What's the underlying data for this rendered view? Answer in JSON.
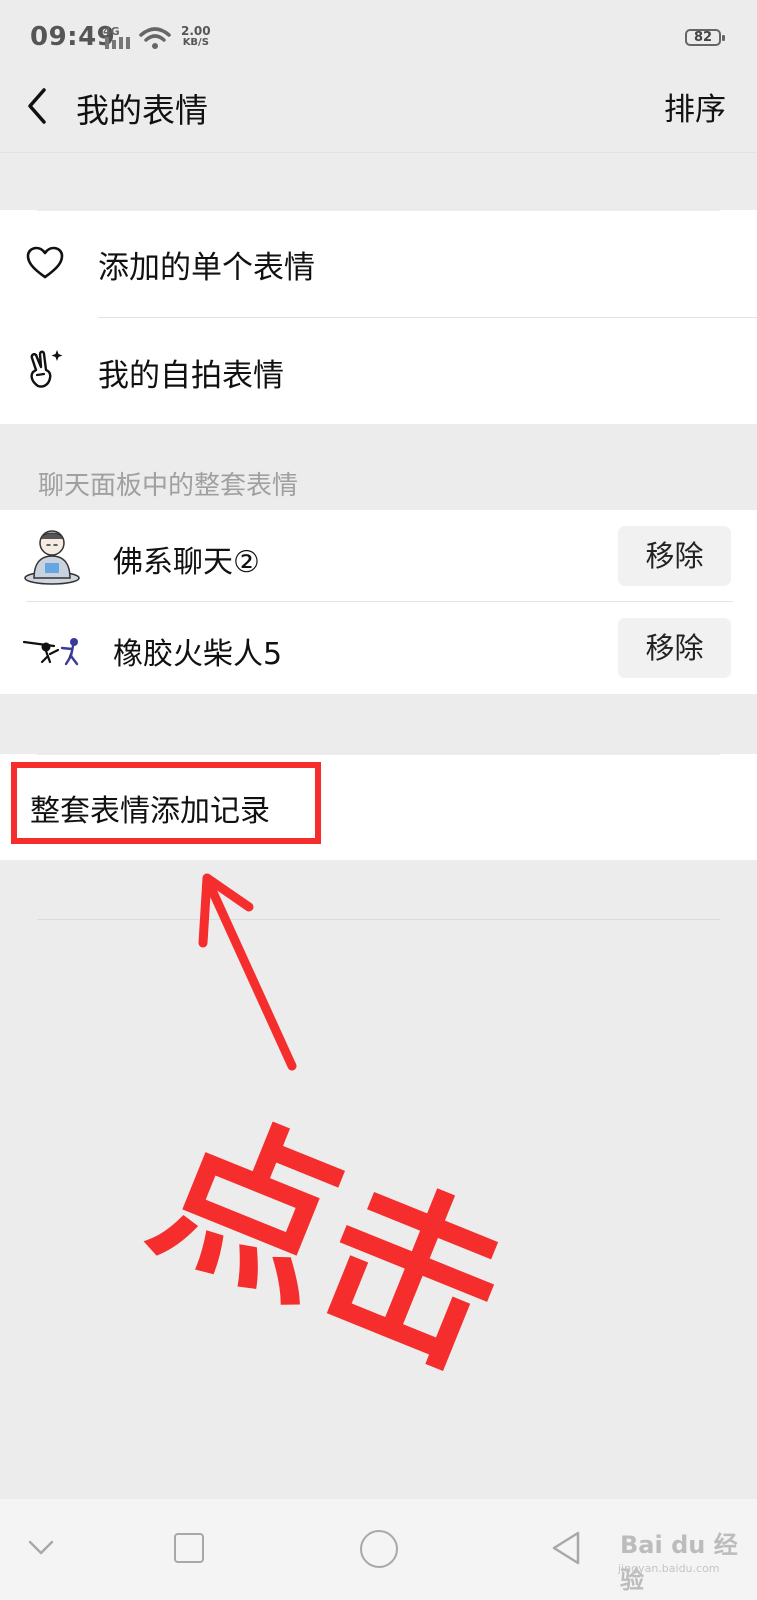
{
  "status_bar": {
    "time": "09:49",
    "network": "4G",
    "speed_value": "2.00",
    "speed_unit": "KB/S",
    "battery": "82"
  },
  "header": {
    "back_icon": "chevron-left-icon",
    "title": "我的表情",
    "sort_label": "排序"
  },
  "top_items": [
    {
      "icon": "heart-outline-icon",
      "label": "添加的单个表情"
    },
    {
      "icon": "victory-hand-sparkle-icon",
      "label": "我的自拍表情"
    }
  ],
  "section_header": "聊天面板中的整套表情",
  "sticker_sets": [
    {
      "thumb": "meditating-man-sticker-thumbnail",
      "name": "佛系聊天②",
      "action": "移除"
    },
    {
      "thumb": "stick-figure-sticker-thumbnail",
      "name": "橡胶火柴人5",
      "action": "移除"
    }
  ],
  "history_row": {
    "label": "整套表情添加记录"
  },
  "annotation": {
    "text": "点击",
    "color": "#f52d2d"
  },
  "nav_bar": {
    "icons": [
      "collapse-chevron-icon",
      "recents-square-icon",
      "home-circle-icon",
      "back-triangle-icon"
    ]
  },
  "watermark": {
    "brand": "Bai du 经验",
    "url": "jingyan.baidu.com"
  },
  "colors": {
    "background": "#ececec",
    "panel": "#ffffff",
    "button": "#f1f1f1",
    "accent_red": "#f52d2d"
  }
}
